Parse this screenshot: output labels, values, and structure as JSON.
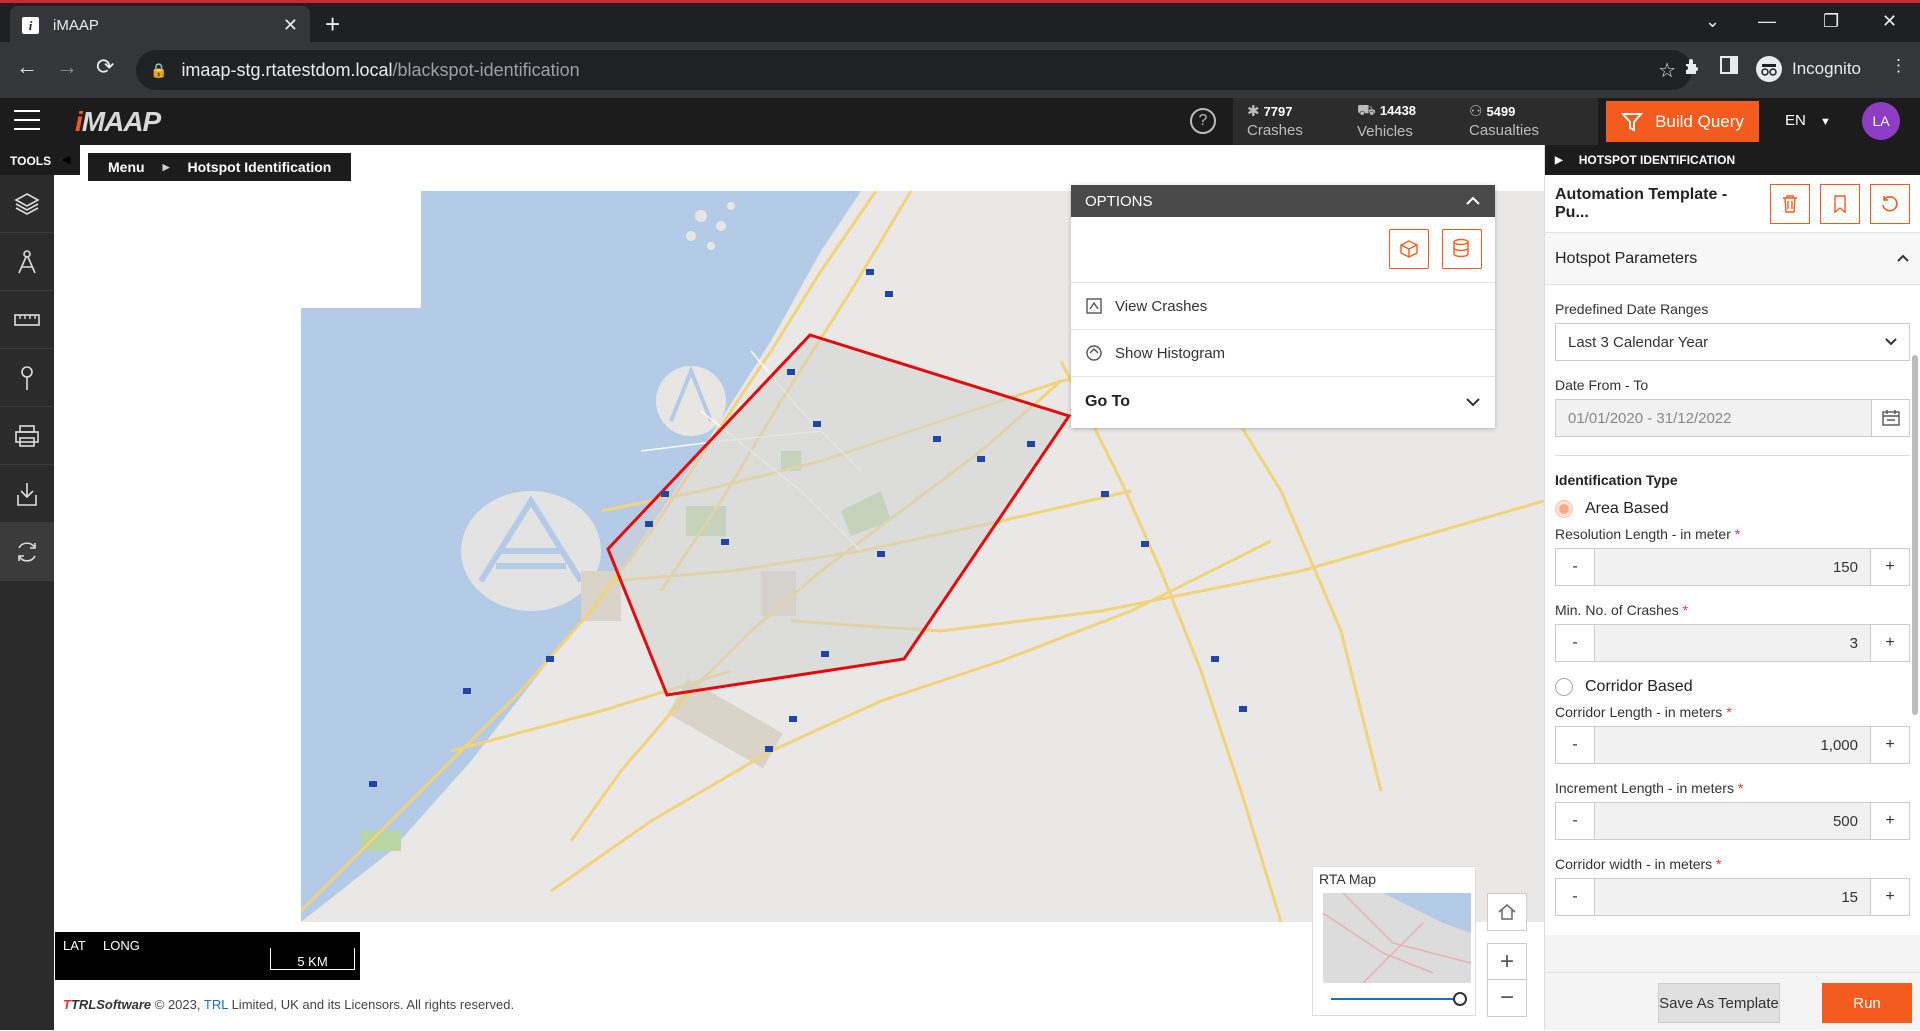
{
  "browser": {
    "tab_title": "iMAAP",
    "tab_icon": "i",
    "url_host": "imaap-stg.rtatestdom.local",
    "url_path": "/blackspot-identification",
    "profile_label": "Incognito"
  },
  "header": {
    "logo": "iMAAP",
    "stats": [
      {
        "value": "7797",
        "label": "Crashes",
        "icon": "crash-icon"
      },
      {
        "value": "14438",
        "label": "Vehicles",
        "icon": "car-icon"
      },
      {
        "value": "5499",
        "label": "Casualties",
        "icon": "person-icon"
      }
    ],
    "build_query_label": "Build Query",
    "language": "EN",
    "avatar_initials": "LA",
    "accent_color": "#f35c1e"
  },
  "tools": {
    "label": "TOOLS",
    "items": [
      "layers-icon",
      "measure-icon",
      "ruler-icon",
      "pin-icon",
      "print-icon",
      "download-icon",
      "refresh-icon"
    ]
  },
  "breadcrumb": {
    "root": "Menu",
    "current": "Hotspot Identification"
  },
  "options": {
    "title": "OPTIONS",
    "view_crashes": "View Crashes",
    "show_histogram": "Show Histogram",
    "go_to": "Go To"
  },
  "map": {
    "lat_label": "LAT",
    "long_label": "LONG",
    "scale_label": "5 KM",
    "rta_map_label": "RTA Map",
    "copyright_brand": "TRLSoftware",
    "copyright_text": "© 2023,",
    "copyright_link": "TRL",
    "copyright_rest": "Limited, UK and its Licensors. All rights reserved."
  },
  "panel": {
    "header": "HOTSPOT IDENTIFICATION",
    "template_name": "Automation Template - Pu...",
    "section_title": "Hotspot Parameters",
    "date_range_label": "Predefined Date Ranges",
    "date_range_value": "Last 3 Calendar Year",
    "date_from_to_label": "Date From - To",
    "date_from_to_value": "01/01/2020 - 31/12/2022",
    "identification_type_label": "Identification Type",
    "area_based_label": "Area Based",
    "resolution_label": "Resolution Length - in meter",
    "resolution_value": "150",
    "min_crashes_label": "Min. No. of Crashes",
    "min_crashes_value": "3",
    "corridor_based_label": "Corridor Based",
    "corridor_length_label": "Corridor Length - in meters",
    "corridor_length_value": "1,000",
    "increment_label": "Increment Length - in meters",
    "increment_value": "500",
    "corridor_width_label": "Corridor width - in meters",
    "corridor_width_value": "15",
    "required_mark": "*",
    "minus": "-",
    "plus": "+",
    "save_template_label": "Save As Template",
    "run_label": "Run"
  }
}
